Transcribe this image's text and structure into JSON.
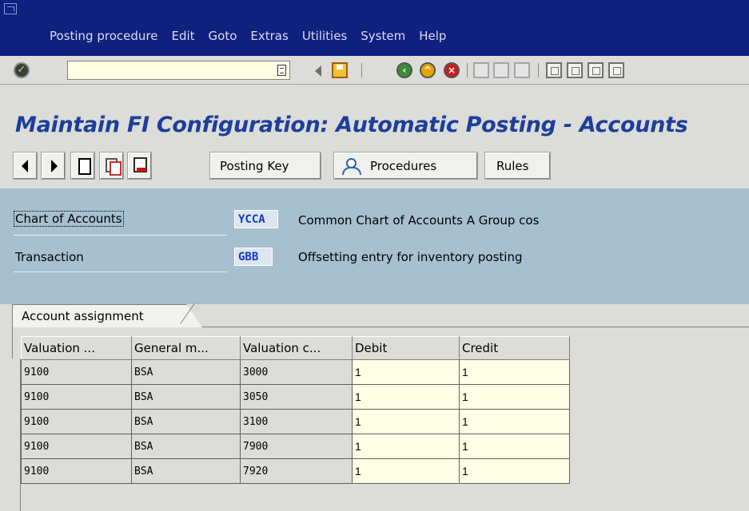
{
  "menu": [
    "Posting procedure",
    "Edit",
    "Goto",
    "Extras",
    "Utilities",
    "System",
    "Help"
  ],
  "toolbar": {
    "command_field_value": "",
    "icons": [
      "enter-icon",
      "back-icon",
      "save-icon",
      "back-green-icon",
      "exit-icon",
      "cancel-icon",
      "print-icon",
      "find-icon",
      "find-next-icon",
      "first-page-icon",
      "previous-page-icon",
      "next-page-icon",
      "last-page-icon"
    ]
  },
  "title": "Maintain FI Configuration: Automatic Posting - Accounts",
  "app_toolbar": {
    "posting_key": "Posting Key",
    "procedures": "Procedures",
    "rules": "Rules"
  },
  "header": {
    "chart_label": "Chart of Accounts",
    "chart_code": "YCCA",
    "chart_desc": "Common Chart of Accounts A Group cos",
    "transaction_label": "Transaction",
    "transaction_code": "GBB",
    "transaction_desc": "Offsetting entry for inventory posting"
  },
  "tab": {
    "label": "Account assignment"
  },
  "table": {
    "columns": [
      "Valuation ...",
      "General m...",
      "Valuation c...",
      "Debit",
      "Credit"
    ],
    "rows": [
      [
        "9100",
        "BSA",
        "3000",
        "1",
        "1"
      ],
      [
        "9100",
        "BSA",
        "3050",
        "1",
        "1"
      ],
      [
        "9100",
        "BSA",
        "3100",
        "1",
        "1"
      ],
      [
        "9100",
        "BSA",
        "7900",
        "1",
        "1"
      ],
      [
        "9100",
        "BSA",
        "7920",
        "1",
        "1"
      ]
    ]
  }
}
